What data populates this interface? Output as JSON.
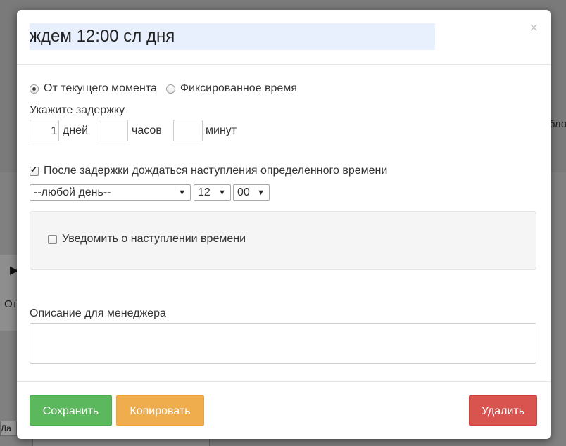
{
  "background": {
    "side_text_left": "От",
    "side_text_right": "бло",
    "side_button": "Да"
  },
  "modal": {
    "title_value": "ждем 12:00 сл дня",
    "close_icon": "close-icon"
  },
  "start_mode": {
    "from_now_label": "От текущего момента",
    "from_now_checked": true,
    "fixed_time_label": "Фиксированное время",
    "fixed_time_checked": false
  },
  "delay": {
    "label": "Укажите задержку",
    "days_value": "1",
    "days_unit": "дней",
    "hours_value": "",
    "hours_unit": "часов",
    "minutes_value": "",
    "minutes_unit": "минут"
  },
  "wait_time": {
    "label": "После задержки дождаться наступления определенного времени",
    "checked": true,
    "day_select": "--любой день--",
    "hour_select": "12",
    "minute_select": "00"
  },
  "notify": {
    "label": "Уведомить о наступлении времени",
    "checked": false
  },
  "description": {
    "label": "Описание для менеджера",
    "value": ""
  },
  "footer": {
    "save_label": "Сохранить",
    "copy_label": "Копировать",
    "delete_label": "Удалить"
  }
}
